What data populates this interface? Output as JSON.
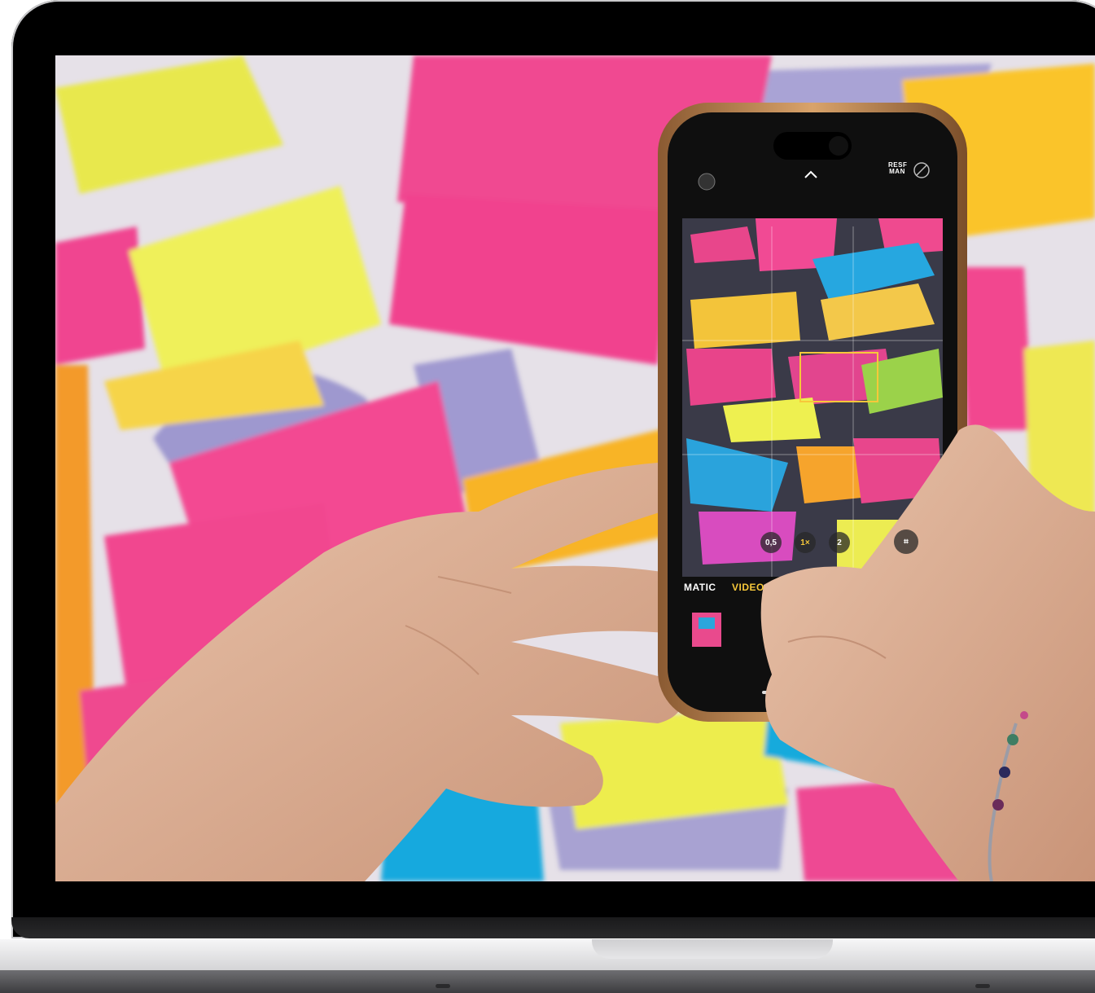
{
  "camera_ui": {
    "mode_left": "MATIC",
    "mode_right": "VIDEO",
    "zoom_options": [
      "0,5",
      "1×",
      "2"
    ],
    "top_right_badge": "RESF MAN"
  },
  "colors": {
    "pink": "#f0438f",
    "yellow": "#eef04c",
    "orange": "#f7a52a",
    "blue": "#18a8dd",
    "wall": "#e7e2ea",
    "phone_frame": "#b8895e"
  }
}
